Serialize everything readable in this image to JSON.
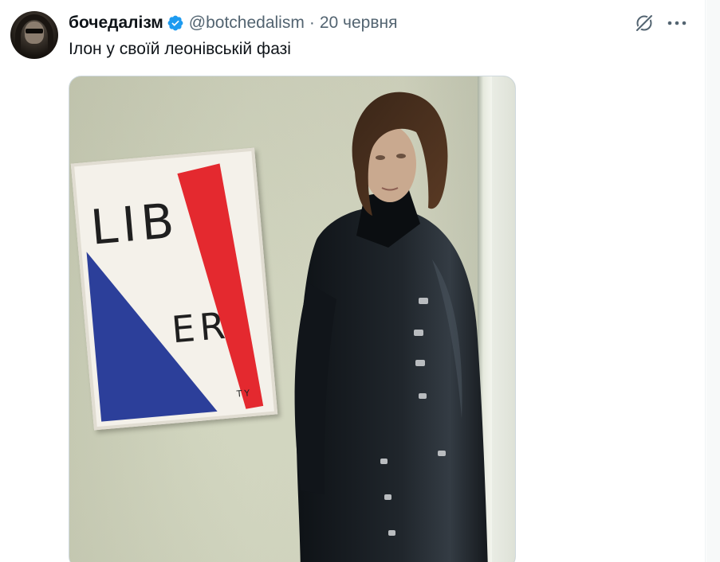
{
  "author": {
    "display_name": "бочедалізм",
    "handle": "@botchedalism",
    "separator": "·",
    "date": "20 червня",
    "verified": true,
    "verified_icon": "verified-badge-icon"
  },
  "tweet": {
    "text": "Ілон у своїй леонівській фазі"
  },
  "actions": {
    "grok_icon": "grok-icon",
    "more_icon": "more-icon"
  },
  "media": {
    "poster_lines": [
      "LIB",
      "ER",
      "TY"
    ]
  },
  "colors": {
    "verified_blue": "#1d9bf0",
    "text_primary": "#0f1419",
    "text_secondary": "#536471",
    "poster_red": "#e4292f",
    "poster_blue": "#2c3f9a"
  }
}
